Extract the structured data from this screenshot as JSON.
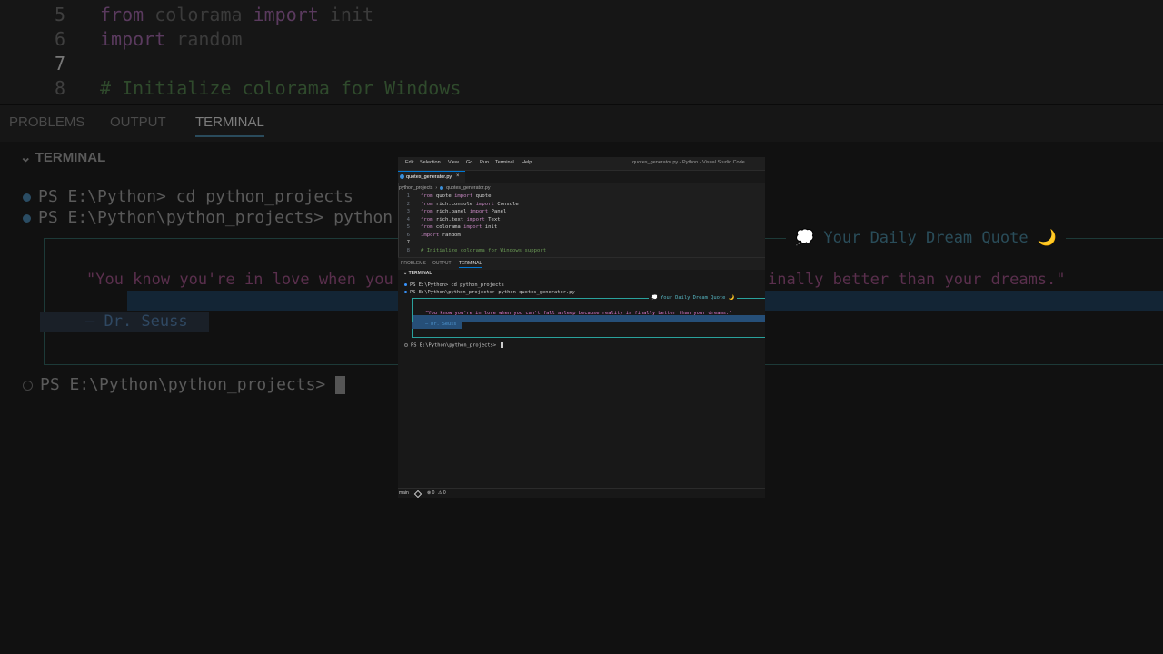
{
  "background": {
    "code_lines": [
      {
        "num": "5",
        "pre": "",
        "kw": "from",
        "mid": " colorama ",
        "kw2": "import",
        "post": " init",
        "current": false
      },
      {
        "num": "6",
        "pre": "",
        "kw": "import",
        "mid": " random",
        "kw2": "",
        "post": "",
        "current": false
      },
      {
        "num": "7",
        "pre": "",
        "kw": "",
        "mid": "",
        "kw2": "",
        "post": "",
        "current": true
      },
      {
        "num": "8",
        "comment": "# Initialize colorama for Windows"
      }
    ],
    "tabs": [
      "PROBLEMS",
      "OUTPUT",
      "TERMINAL"
    ],
    "terminal_header": "TERMINAL",
    "cmd1": "PS E:\\Python> cd python_projects",
    "cmd2": "PS E:\\Python\\python_projects> python qu",
    "panel_title": "💭 Your Daily Dream Quote 🌙",
    "quote_left": "\"You know you're in love when you",
    "quote_right": "inally better than your dreams.\"",
    "author": "— Dr. Seuss",
    "prompt": "PS E:\\Python\\python_projects> "
  },
  "window": {
    "menu": [
      "Edit",
      "Selection",
      "View",
      "Go",
      "Run",
      "Terminal",
      "Help"
    ],
    "title": "quotes_generator.py - Python - Visual Studio Code",
    "tab_label": "quotes_generator.py",
    "tab_close": "×",
    "breadcrumb": [
      "python_projects",
      "quotes_generator.py"
    ],
    "code": [
      {
        "num": "1",
        "a": "from",
        "b": " quote ",
        "c": "import",
        "d": " quote"
      },
      {
        "num": "2",
        "a": "from",
        "b": " rich.console ",
        "c": "import",
        "d": " Console"
      },
      {
        "num": "3",
        "a": "from",
        "b": " rich.panel ",
        "c": "import",
        "d": " Panel"
      },
      {
        "num": "4",
        "a": "from",
        "b": " rich.text ",
        "c": "import",
        "d": " Text"
      },
      {
        "num": "5",
        "a": "from",
        "b": " colorama ",
        "c": "import",
        "d": " init"
      },
      {
        "num": "6",
        "a": "import",
        "b": " random",
        "c": "",
        "d": ""
      },
      {
        "num": "7",
        "a": "",
        "b": "",
        "c": "",
        "d": ""
      },
      {
        "num": "8",
        "comment": "# Initialize colorama for Windows support"
      }
    ],
    "panel_tabs": [
      "PROBLEMS",
      "OUTPUT",
      "TERMINAL"
    ],
    "terminal": {
      "header": "TERMINAL",
      "cmd1": "PS E:\\Python> cd python_projects",
      "cmd2": "PS E:\\Python\\python_projects> python quotes_generator.py",
      "panel_title": "💭 Your Daily Dream Quote 🌙",
      "quote": "\"You know you're in love when you can't fall asleep because reality is finally better than your dreams.\"",
      "author": "— Dr. Seuss",
      "prompt": "PS E:\\Python\\python_projects> "
    },
    "status": {
      "branch": "main",
      "errors": "⊗ 0",
      "warnings": "⚠ 0"
    }
  },
  "colors": {
    "keyword": "#c586c0",
    "comment": "#6a9955",
    "quote": "#e07ad1",
    "panel_border": "#2aa19c",
    "selection": "#264f78"
  }
}
